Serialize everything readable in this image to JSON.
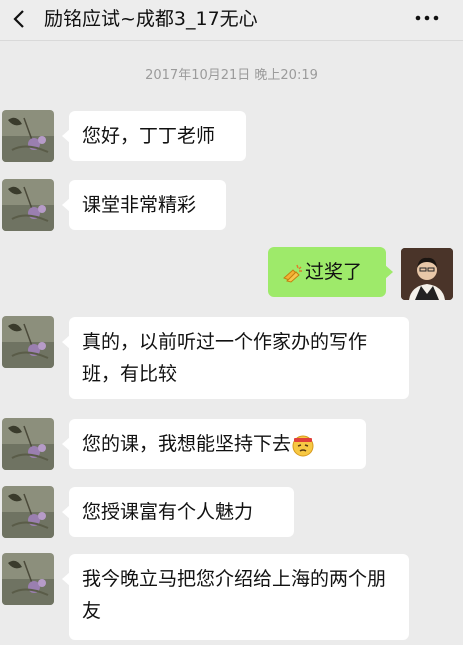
{
  "header": {
    "back_icon": "chevron-left-icon",
    "title": "励铭应试~成都3_17无心",
    "more_icon": "more-dots-icon"
  },
  "chat": {
    "timestamp": "2017年10月21日 晚上20:19",
    "messages": [
      {
        "sender": "other",
        "text": "您好，丁丁老师"
      },
      {
        "sender": "other",
        "text": "课堂非常精彩"
      },
      {
        "sender": "self",
        "emoji": "clap-hands-emoji",
        "text": "过奖了"
      },
      {
        "sender": "other",
        "text": "真的，以前听过一个作家办的写作班，有比较"
      },
      {
        "sender": "other",
        "text": "您的课，我想能坚持下去",
        "emoji": "determined-face-emoji"
      },
      {
        "sender": "other",
        "text": "您授课富有个人魅力"
      },
      {
        "sender": "other",
        "text": "我今晚立马把您介绍给上海的两个朋友"
      }
    ]
  },
  "colors": {
    "background": "#ebebeb",
    "received_bubble": "#ffffff",
    "sent_bubble": "#9eea6a"
  }
}
